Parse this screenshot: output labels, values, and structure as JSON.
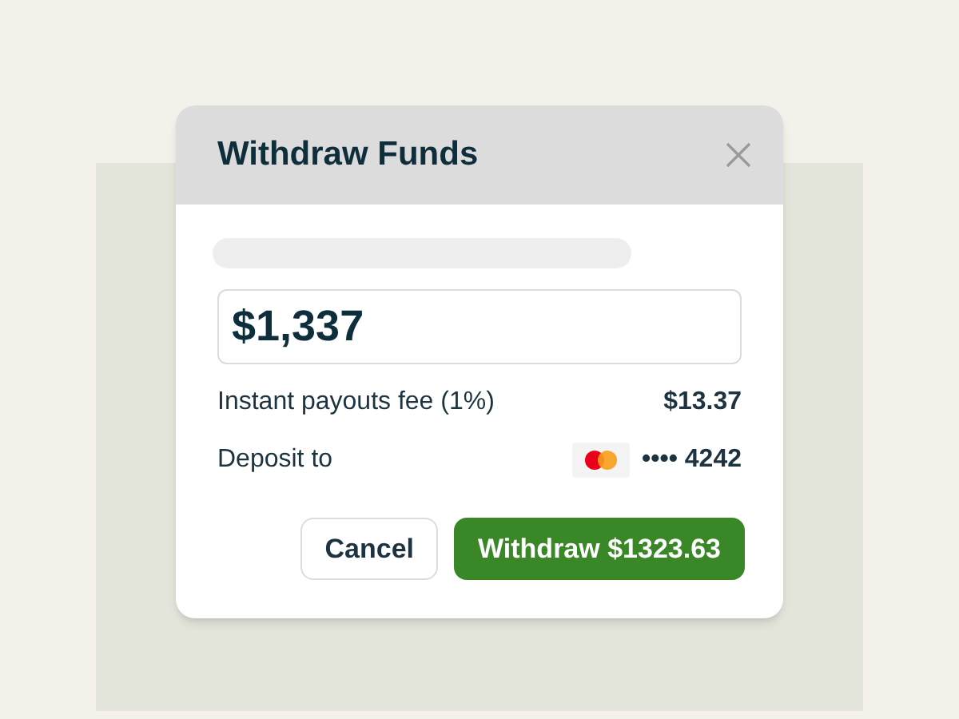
{
  "dialog": {
    "title": "Withdraw Funds",
    "amount": "$1,337",
    "rows": [
      {
        "label": "Instant payouts fee (1%)",
        "value": "$13.37"
      },
      {
        "label": "Deposit to",
        "value": "•••• 4242"
      }
    ],
    "buttons": [
      {
        "label": "Cancel",
        "kind": "secondary"
      },
      {
        "label": "Withdraw $1323.63",
        "kind": "primary"
      }
    ]
  }
}
